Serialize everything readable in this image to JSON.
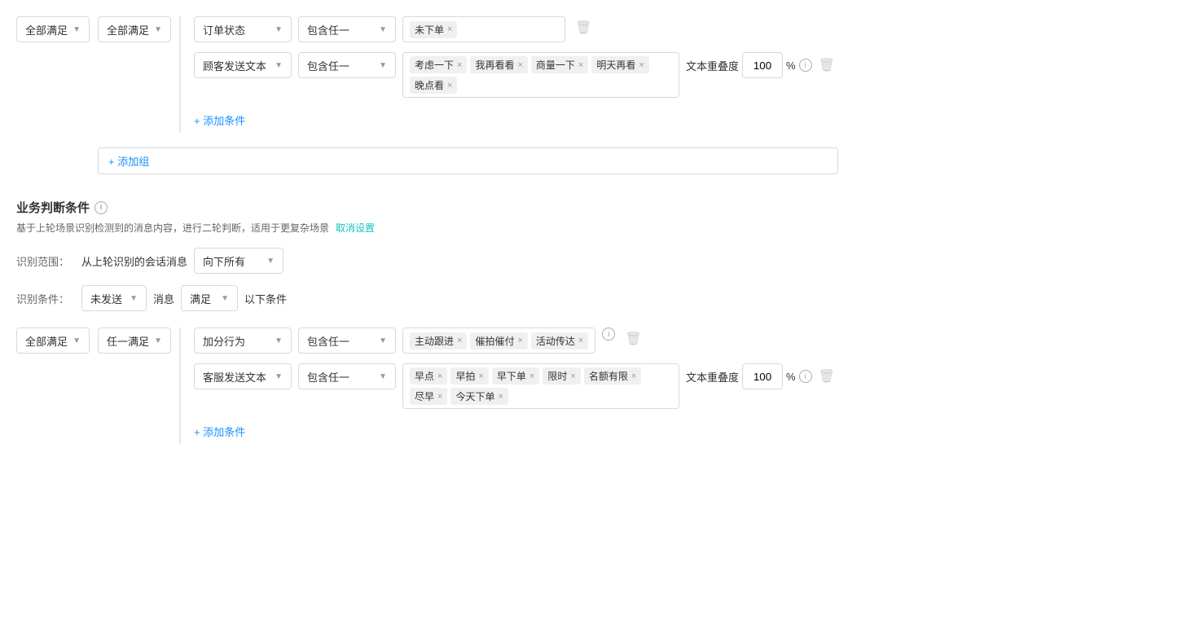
{
  "top_section": {
    "outer_satisfy": "全部满足",
    "inner_satisfy": "全部满足",
    "row1": {
      "field": "订单状态",
      "operator": "包含任一",
      "tags": [
        "未下单"
      ]
    },
    "row2": {
      "field": "顾客发送文本",
      "operator": "包含任一",
      "tags": [
        "考虑一下",
        "我再看看",
        "商量一下",
        "明天再看",
        "晚点看"
      ],
      "density_label": "文本重叠度",
      "density_value": "100",
      "density_unit": "%"
    },
    "add_condition": "+ 添加条件",
    "add_group": "+ 添加组"
  },
  "biz_section": {
    "title": "业务判断条件",
    "desc": "基于上轮场景识别检测到的消息内容，进行二轮判断，适用于更复杂场景",
    "cancel_link": "取消设置",
    "scope_label": "识别范围：",
    "scope_text1": "从上轮识别的会话消息",
    "scope_dropdown": "向下所有",
    "condition_label": "识别条件：",
    "condition_send": "未发送",
    "condition_msg": "消息",
    "condition_satisfy": "满足",
    "condition_suffix": "以下条件"
  },
  "bottom_section": {
    "outer_satisfy": "全部满足",
    "inner_satisfy": "任一满足",
    "row1": {
      "field": "加分行为",
      "operator": "包含任一",
      "tags": [
        "主动跟进",
        "催拍催付",
        "活动传达"
      ]
    },
    "row2": {
      "field": "客服发送文本",
      "operator": "包含任一",
      "tags": [
        "早点",
        "早拍",
        "早下单",
        "限时",
        "名额有限",
        "尽早",
        "今天下单"
      ],
      "density_label": "文本重叠度",
      "density_value": "100",
      "density_unit": "%"
    },
    "add_condition": "+ 添加条件"
  }
}
